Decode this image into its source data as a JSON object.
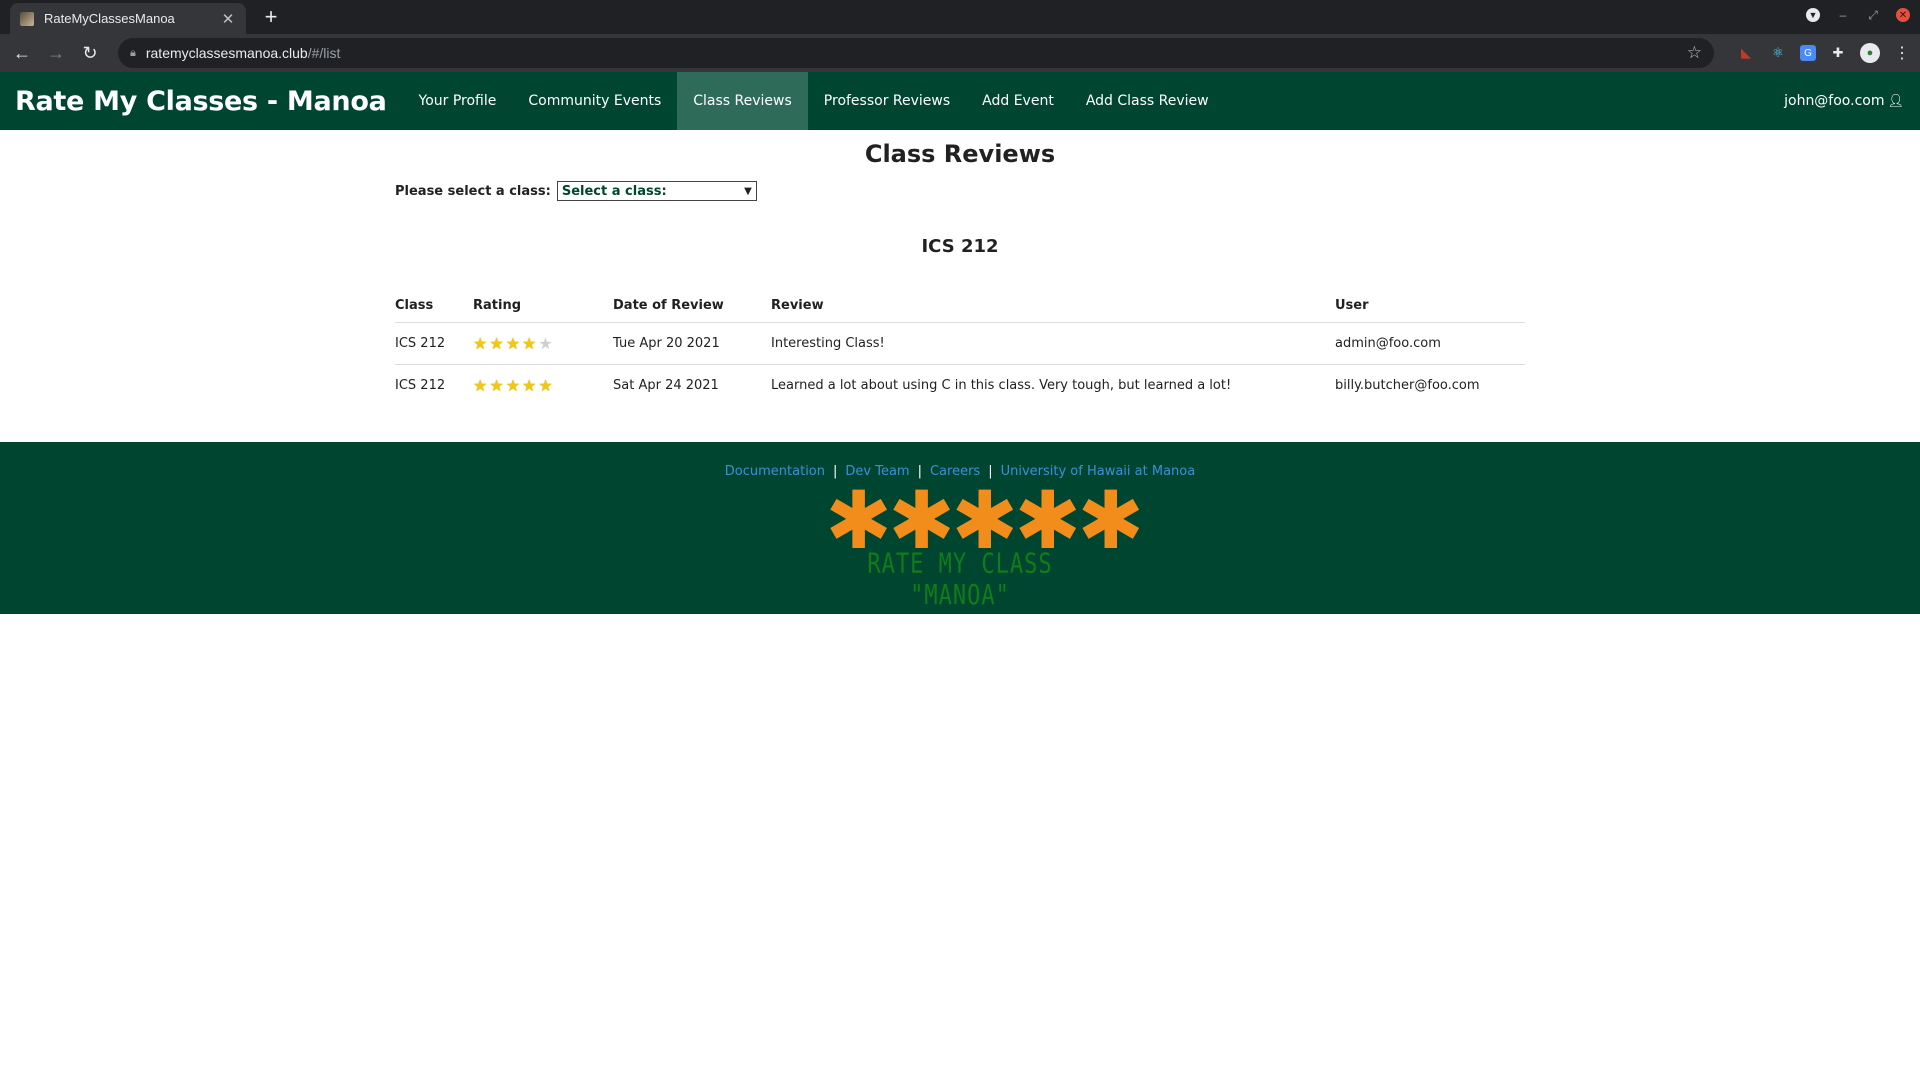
{
  "browser": {
    "tab_title": "RateMyClassesManoa",
    "url_host": "ratemyclassesmanoa.club",
    "url_path": "/#/list"
  },
  "navbar": {
    "brand": "Rate My Classes - Manoa",
    "items": [
      {
        "label": "Your Profile",
        "active": false
      },
      {
        "label": "Community Events",
        "active": false
      },
      {
        "label": "Class Reviews",
        "active": true
      },
      {
        "label": "Professor Reviews",
        "active": false
      },
      {
        "label": "Add Event",
        "active": false
      },
      {
        "label": "Add Class Review",
        "active": false
      }
    ],
    "user": "john@foo.com"
  },
  "page": {
    "title": "Class Reviews",
    "select_label": "Please select a class:",
    "select_value": "Select a class:",
    "section_title": "ICS 212"
  },
  "table": {
    "headers": [
      "Class",
      "Rating",
      "Date of Review",
      "Review",
      "User"
    ],
    "rows": [
      {
        "class": "ICS 212",
        "rating": 4,
        "max_rating": 5,
        "date": "Tue Apr 20 2021",
        "review": "Interesting Class!",
        "user": "admin@foo.com"
      },
      {
        "class": "ICS 212",
        "rating": 5,
        "max_rating": 5,
        "date": "Sat Apr 24 2021",
        "review": "Learned a lot about using C in this class. Very tough, but learned a lot!",
        "user": "billy.butcher@foo.com"
      }
    ]
  },
  "footer": {
    "links": [
      "Documentation",
      "Dev Team",
      "Careers",
      "University of Hawaii at Manoa"
    ],
    "separator": "|",
    "logo_symbols": "✱✱✱✱✱",
    "logo_text": "RATE MY CLASS \"MANOA\""
  },
  "colors": {
    "nav_bg": "#004530",
    "nav_active": "#2e6b58",
    "link": "#3b8fd9",
    "logo_orange": "#f28c1a",
    "logo_green": "#0f7d1a",
    "star": "#f2c80f"
  }
}
